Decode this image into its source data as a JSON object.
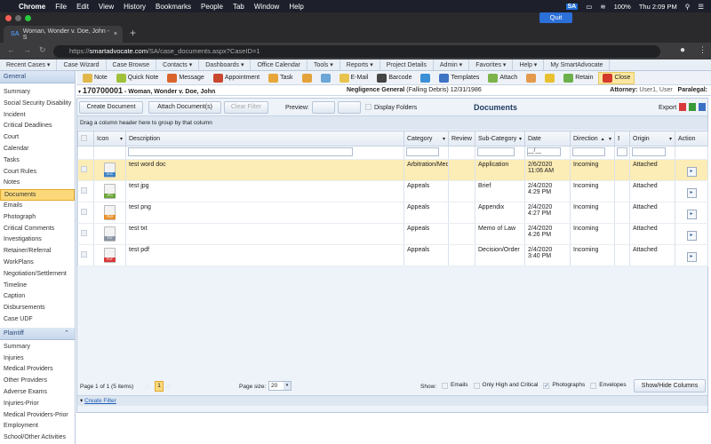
{
  "macos": {
    "apple": "",
    "app": "Chrome",
    "menus": [
      "File",
      "Edit",
      "View",
      "History",
      "Bookmarks",
      "People",
      "Tab",
      "Window",
      "Help"
    ],
    "sa_badge": "SA",
    "battery": "100%",
    "clock": "Thu 2:09 PM",
    "quit": "Quit"
  },
  "browser": {
    "tab_title": "Woman, Wonder v. Doe, John - S",
    "tab_favicon": "SA",
    "url_host": "smartadvocate.com",
    "url_prefix": "https://",
    "url_path": "/SA/case_documents.aspx?CaseID=1"
  },
  "menu": [
    "Recent Cases ▾",
    "Case Wizard",
    "Case Browse",
    "Contacts ▾",
    "Dashboards ▾",
    "Office Calendar",
    "Tools ▾",
    "Reports ▾",
    "Project Details",
    "Admin ▾",
    "Favorites ▾",
    "Help ▾",
    "My SmartAdvocate"
  ],
  "sidebar": {
    "general_header": "General",
    "general_items": [
      "Summary",
      "Social Security Disability",
      "Incident",
      "Critical Deadlines",
      "Court",
      "Calendar",
      "Tasks",
      "Court Rules",
      "Notes",
      "Documents",
      "Emails",
      "Photograph",
      "Critical Comments",
      "Investigations",
      "Retainer/Referral",
      "WorkPlans",
      "Negotiation/Settlement",
      "Timeline",
      "Caption",
      "Disbursements",
      "Case UDF"
    ],
    "selected": "Documents",
    "plaintiff_header": "Plaintiff",
    "plaintiff_items": [
      "Summary",
      "Injuries",
      "Medical Providers",
      "Other Providers",
      "Adverse Exams",
      "Injuries-Prior",
      "Medical Providers-Prior",
      "Employment",
      "School/Other Activities"
    ]
  },
  "toolbar": [
    {
      "label": "Note",
      "color": "#e0b84a"
    },
    {
      "label": "Quick Note",
      "color": "#9fc13a"
    },
    {
      "label": "Message",
      "color": "#d9652c"
    },
    {
      "label": "Appointment",
      "color": "#c9472f"
    },
    {
      "label": "Task",
      "color": "#e6a63a"
    },
    {
      "label": "",
      "color": "#e3a23a"
    },
    {
      "label": "",
      "color": "#6aa6d8"
    },
    {
      "label": "E-Mail",
      "color": "#e8c34d"
    },
    {
      "label": "Barcode",
      "color": "#444444"
    },
    {
      "label": "",
      "color": "#3a8fd6"
    },
    {
      "label": "Templates",
      "color": "#3d74c4"
    },
    {
      "label": "Attach",
      "color": "#7db34a"
    },
    {
      "label": "",
      "color": "#e49a4a"
    },
    {
      "label": "",
      "color": "#e8c030"
    },
    {
      "label": "Retain",
      "color": "#6bb04a"
    },
    {
      "label": "Close",
      "color": "#d43a2a"
    }
  ],
  "case": {
    "number": "170700001",
    "title": " - Woman, Wonder v. Doe, John",
    "type": "Negligence General",
    "type_detail": " (Falling Debris) 12/31/1986",
    "attorney_label": "Attorney:",
    "attorney": " User1, User",
    "paralegal_label": "Paralegal:"
  },
  "docs": {
    "create": "Create Document",
    "attach": "Attach Document(s)",
    "clear": "Clear Filter",
    "preview": "Preview:",
    "display_folders": "Display Folders",
    "title": "Documents",
    "export": "Export",
    "group_hint": "Drag a column header here to group by that column",
    "columns": [
      "",
      "Icon",
      "Description",
      "Category",
      "Review",
      "Sub-Category",
      "Date",
      "Direction",
      "!",
      "Origin",
      "Action"
    ],
    "date_filter": "__/__",
    "rows": [
      {
        "type": "DOC",
        "color": "#3b82c4",
        "description": "test word doc",
        "category": "Arbitration/Med",
        "subcategory": "Application",
        "date": "2/6/2020",
        "time": "11:06 AM",
        "direction": "Incoming",
        "origin": "Attached",
        "highlight": true
      },
      {
        "type": "JPG",
        "color": "#6aa53a",
        "description": "test jpg",
        "category": "Appeals",
        "subcategory": "Brief",
        "date": "2/4/2020",
        "time": "4:29 PM",
        "direction": "Incoming",
        "origin": "Attached",
        "highlight": false
      },
      {
        "type": "PNG",
        "color": "#e8902a",
        "description": "test png",
        "category": "Appeals",
        "subcategory": "Appendix",
        "date": "2/4/2020",
        "time": "4:27 PM",
        "direction": "Incoming",
        "origin": "Attached",
        "highlight": false
      },
      {
        "type": "TXT",
        "color": "#8b96a4",
        "description": "test txt",
        "category": "Appeals",
        "subcategory": "Memo of Law",
        "date": "2/4/2020",
        "time": "4:26 PM",
        "direction": "Incoming",
        "origin": "Attached",
        "highlight": false
      },
      {
        "type": "PDF",
        "color": "#d8393a",
        "description": "test pdf",
        "category": "Appeals",
        "subcategory": "Decision/Order",
        "date": "2/4/2020",
        "time": "3:40 PM",
        "direction": "Incoming",
        "origin": "Attached",
        "highlight": false
      }
    ],
    "pager": {
      "info": "Page 1 of 1 (5 items)",
      "current": "1",
      "page_size_label": "Page size:",
      "page_size": "20",
      "show_label": "Show:",
      "filters": [
        {
          "label": "Emails",
          "checked": false
        },
        {
          "label": "Only High and Critical",
          "checked": false
        },
        {
          "label": "Photographs",
          "checked": true
        },
        {
          "label": "Envelopes",
          "checked": false
        }
      ],
      "show_hide": "Show/Hide Columns"
    },
    "create_filter": "Create Filter"
  }
}
